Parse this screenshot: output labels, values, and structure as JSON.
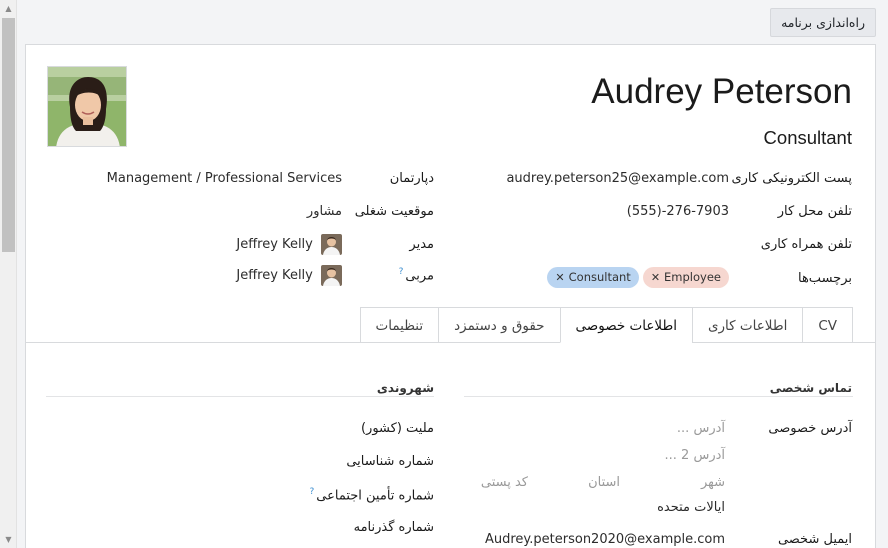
{
  "setup_button": "راه‌اندازی برنامه",
  "employee": {
    "name": "Audrey Peterson",
    "job_title": "Consultant"
  },
  "fields": {
    "work_email_label": "پست الکترونیکی کاری",
    "work_email": "audrey.peterson25@example.com",
    "work_phone_label": "تلفن محل کار",
    "work_phone": "(555)-276-7903",
    "work_mobile_label": "تلفن همراه کاری",
    "tags_label": "برچسب‌ها",
    "department_label": "دپارتمان",
    "department": "Management / Professional Services",
    "job_position_label": "موقعیت شغلی",
    "job_position": "مشاور",
    "manager_label": "مدیر",
    "manager": "Jeffrey Kelly",
    "coach_label": "مربی",
    "coach": "Jeffrey Kelly",
    "help_mark": "?"
  },
  "tags": [
    {
      "label": "Employee",
      "color": "#f6d7d0"
    },
    {
      "label": "Consultant",
      "color": "#b9d4f1"
    }
  ],
  "tabs": [
    {
      "label": "CV",
      "active": false
    },
    {
      "label": "اطلاعات کاری",
      "active": false
    },
    {
      "label": "اطلاعات خصوصی",
      "active": true
    },
    {
      "label": "حقوق و دستمزد",
      "active": false
    },
    {
      "label": "تنظیمات",
      "active": false
    }
  ],
  "private": {
    "contact_section": "تماس شخصی",
    "address_label": "آدرس خصوصی",
    "address_placeholder": "آدرس ...",
    "address2_placeholder": "آدرس 2 ...",
    "city_placeholder": "شهر",
    "state_placeholder": "استان",
    "zip_placeholder": "کد پستی",
    "country": "ایالات متحده",
    "email_label": "ایمیل شخصی",
    "email": "Audrey.peterson2020@example.com",
    "citizenship_section": "شهروندی",
    "nationality_label": "ملیت (کشور)",
    "id_label": "شماره شناسایی",
    "ssn_label": "شماره تأمین اجتماعی",
    "passport_label": "شماره گذرنامه"
  }
}
